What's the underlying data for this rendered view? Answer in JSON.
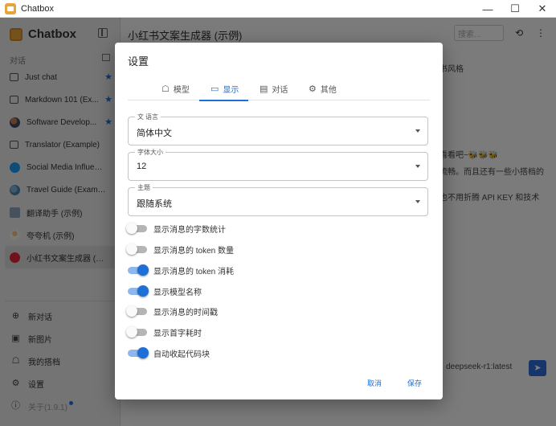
{
  "window": {
    "title": "Chatbox",
    "controls": [
      "—",
      "☐",
      "✕"
    ]
  },
  "sidebar": {
    "brand": "Chatbox",
    "section_label": "对话",
    "chats": [
      {
        "label": "Just chat",
        "icon": "chat-bubble-icon",
        "starred": true
      },
      {
        "label": "Markdown 101 (Ex...",
        "icon": "chat-bubble-icon",
        "starred": true
      },
      {
        "label": "Software Develop...",
        "icon": "avatar-icon",
        "starred": true
      },
      {
        "label": "Translator (Example)",
        "icon": "chat-bubble-icon",
        "starred": false
      },
      {
        "label": "Social Media Influencer ...",
        "icon": "twitter-icon",
        "starred": false
      },
      {
        "label": "Travel Guide (Example)",
        "icon": "globe-icon",
        "starred": false
      },
      {
        "label": "翻译助手 (示例)",
        "icon": "avatar-icon",
        "starred": false
      },
      {
        "label": "夸夸机 (示例)",
        "icon": "avatar-icon",
        "starred": false
      },
      {
        "label": "小红书文案生成器 (示例)",
        "icon": "xiaohongshu-icon",
        "starred": false,
        "active": true
      }
    ],
    "nav": [
      {
        "label": "新对话",
        "icon": "plus-circle-icon"
      },
      {
        "label": "新图片",
        "icon": "image-icon"
      },
      {
        "label": "我的搭档",
        "icon": "robot-icon"
      },
      {
        "label": "设置",
        "icon": "gear-icon"
      },
      {
        "label": "关于(1.9.1)",
        "icon": "info-icon",
        "muted": true,
        "badge": true
      }
    ]
  },
  "main": {
    "title": "小红书文案生成器 (示例)",
    "search_placeholder": "搜索...",
    "bg_lines": [
      "书风格",
      "看看吧~🐝🐝🐝",
      "流畅。而且还有一些小搭档的",
      "也不用折腾 API KEY 和技术"
    ],
    "model": "deepseek-r1:latest"
  },
  "dialog": {
    "title": "设置",
    "tabs": [
      {
        "label": "模型",
        "icon": "robot-icon",
        "active": false
      },
      {
        "label": "显示",
        "icon": "display-icon",
        "active": true
      },
      {
        "label": "对话",
        "icon": "chat-icon",
        "active": false
      },
      {
        "label": "其他",
        "icon": "gear-icon",
        "active": false
      }
    ],
    "fields": {
      "language": {
        "label": "语言",
        "icon": "translate-icon",
        "value": "简体中文"
      },
      "font_size": {
        "label": "字体大小",
        "value": "12"
      },
      "theme": {
        "label": "主题",
        "value": "跟随系统"
      }
    },
    "toggles": [
      {
        "label": "显示消息的字数统计",
        "on": false
      },
      {
        "label": "显示消息的 token 数量",
        "on": false
      },
      {
        "label": "显示消息的 token 消耗",
        "on": true
      },
      {
        "label": "显示模型名称",
        "on": true
      },
      {
        "label": "显示消息的时间戳",
        "on": false
      },
      {
        "label": "显示首字耗时",
        "on": false
      },
      {
        "label": "自动收起代码块",
        "on": true
      }
    ],
    "cancel_label": "取消",
    "save_label": "保存"
  },
  "colors": {
    "accent": "#1e6fd6",
    "star": "#1e6fd6",
    "overlay": "rgba(0,0,0,0.5)"
  }
}
